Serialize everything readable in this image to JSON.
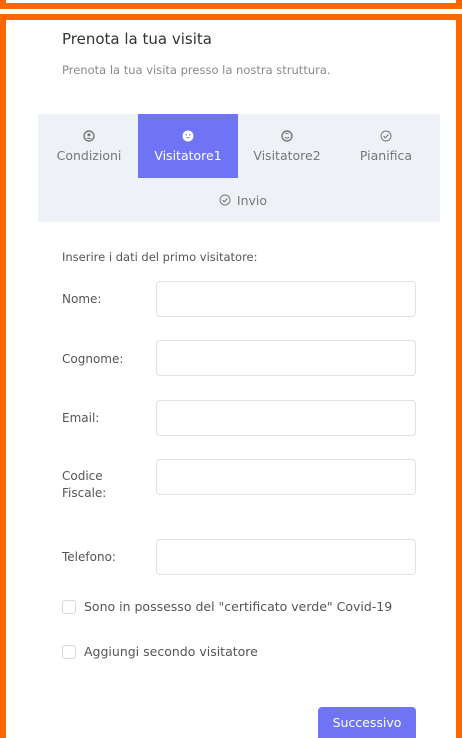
{
  "header": {
    "title": "Prenota la tua visita",
    "subtitle": "Prenota la tua visita presso la nostra struttura."
  },
  "steps": {
    "items": [
      {
        "label": "Condizioni",
        "icon": "user-circle-icon",
        "active": false
      },
      {
        "label": "Visitatore1",
        "icon": "smile-face-icon",
        "active": true
      },
      {
        "label": "Visitatore2",
        "icon": "smile-face-icon",
        "active": false
      },
      {
        "label": "Pianifica",
        "icon": "check-circle-icon",
        "active": false
      },
      {
        "label": "Invio",
        "icon": "check-circle-icon",
        "active": false
      }
    ],
    "active_color": "#6f74f4"
  },
  "form": {
    "intro": "Inserire i dati del primo visitatore:",
    "fields": [
      {
        "label": "Nome:",
        "value": ""
      },
      {
        "label": "Cognome:",
        "value": ""
      },
      {
        "label": "Email:",
        "value": ""
      },
      {
        "label_lines": [
          "Codice",
          "Fiscale:"
        ],
        "value": ""
      },
      {
        "label": "Telefono:",
        "value": ""
      }
    ],
    "checkboxes": [
      {
        "label": "Sono in possesso del \"certificato verde\" Covid-19",
        "checked": false
      },
      {
        "label": "Aggiungi secondo visitatore",
        "checked": false
      }
    ],
    "next_label": "Successivo"
  },
  "theme": {
    "frame_color": "#ff6600",
    "accent": "#6f74f4",
    "steps_background": "#eef1f5"
  }
}
